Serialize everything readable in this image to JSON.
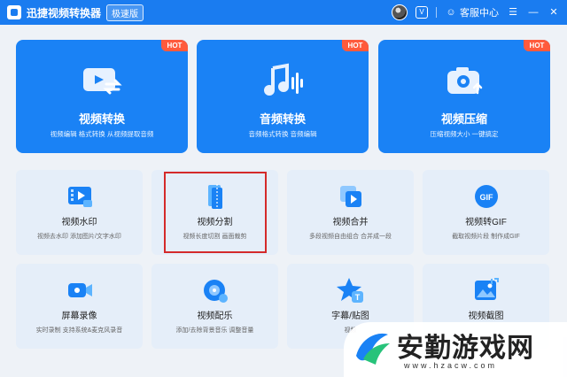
{
  "app": {
    "title": "迅捷视频转换器",
    "edition": "极速版"
  },
  "titlebar": {
    "service": "客服中心",
    "menu_icon": "☰",
    "minimize_icon": "—",
    "close_icon": "✕",
    "vip_icon": "V",
    "service_icon": "☺"
  },
  "featured": [
    {
      "title": "视频转换",
      "desc": "视频编辑 格式转换 从视频提取音频",
      "badge": "HOT"
    },
    {
      "title": "音频转换",
      "desc": "音频格式转换  音频编辑",
      "badge": "HOT"
    },
    {
      "title": "视频压缩",
      "desc": "压缩视频大小  一键搞定",
      "badge": "HOT"
    }
  ],
  "tools": [
    {
      "title": "视频水印",
      "desc": "视频去水印 添加图片/文字水印",
      "icon": "video-watermark-icon"
    },
    {
      "title": "视频分割",
      "desc": "视频长度切割 画面裁剪",
      "icon": "video-split-icon"
    },
    {
      "title": "视频合并",
      "desc": "多段视频自由组合 合并成一段",
      "icon": "video-merge-icon"
    },
    {
      "title": "视频转GIF",
      "desc": "截取视频片段 制作成GIF",
      "icon": "gif-icon"
    },
    {
      "title": "屏幕录像",
      "desc": "实时录制 支持系统&麦克风录音",
      "icon": "screen-record-icon"
    },
    {
      "title": "视频配乐",
      "desc": "添加/去除背景音乐 调整音量",
      "icon": "music-icon"
    },
    {
      "title": "字幕/贴图",
      "desc": "视频",
      "icon": "subtitle-icon"
    },
    {
      "title": "视频截图",
      "desc": "",
      "icon": "screenshot-icon"
    }
  ],
  "watermark": {
    "name": "安勤游戏网",
    "url": "www.hzacw.com"
  },
  "colors": {
    "titlebar": "#1a7cf0",
    "featured_card": "#1a82f5",
    "tool_card": "#e5eef9",
    "hot_badge": "#ff5a3c",
    "highlight": "#d42a2a"
  }
}
